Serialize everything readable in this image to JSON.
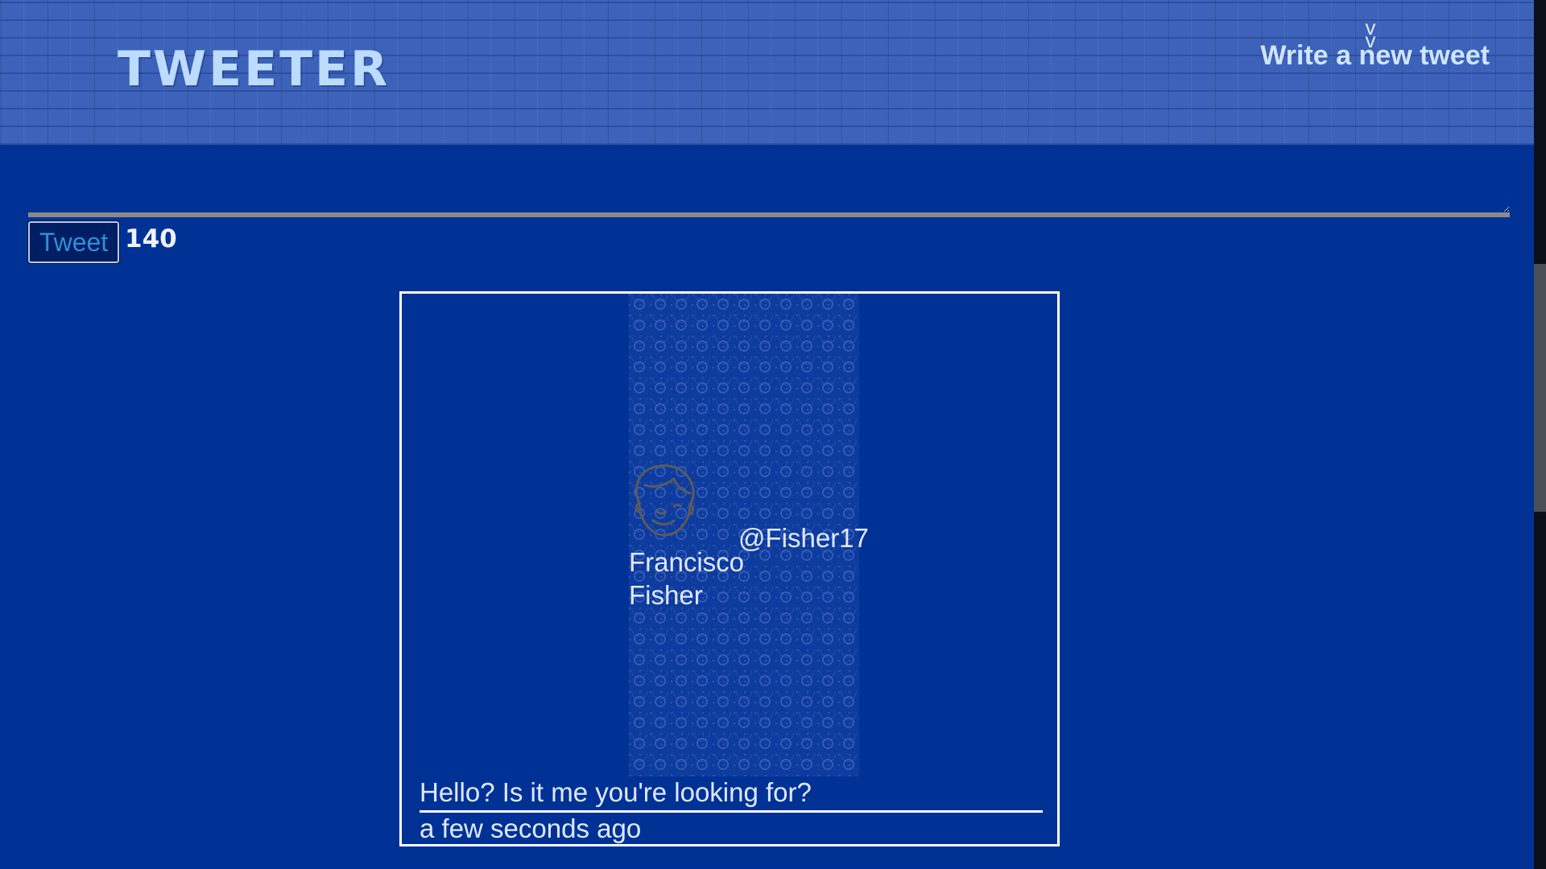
{
  "header": {
    "brand": "TWEETER",
    "compose_toggle_label": "Write a new tweet",
    "chevron_glyph": "v"
  },
  "compose": {
    "textarea_value": "",
    "tweet_button_label": "Tweet",
    "char_counter": "140"
  },
  "tweets": [
    {
      "user_name": "Francisco Fisher",
      "handle": "@Fisher17",
      "avatar_icon": "user-avatar-icon",
      "text": "Hello? Is it me you're looking for?",
      "time": "a few seconds ago"
    }
  ],
  "colors": {
    "background": "#003296",
    "header": "#3c63b9",
    "brand": "#bcdcff",
    "text": "#dfe8ff"
  }
}
